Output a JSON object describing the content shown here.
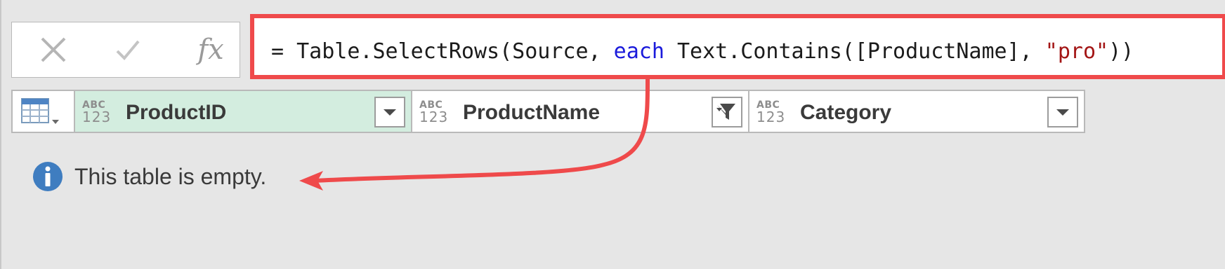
{
  "formula_bar": {
    "controls": [
      {
        "name": "cancel",
        "icon": "close-icon"
      },
      {
        "name": "commit",
        "icon": "checkmark-icon"
      },
      {
        "name": "insert-function",
        "label": "fx"
      }
    ],
    "formula": {
      "prefix": "= Table.SelectRows(Source, ",
      "keyword": "each",
      "middle": " Text.Contains([ProductName], ",
      "string": "\"pro\"",
      "suffix": "))"
    },
    "highlight_color": "#ef4a4b",
    "keyword_color": "#1a1adb",
    "string_color": "#a31515"
  },
  "table": {
    "select_icon": "table-icon",
    "columns": [
      {
        "name": "ProductID",
        "type_top": "ABC",
        "type_bottom": "123",
        "selected": true,
        "filter_icon": "dropdown-icon"
      },
      {
        "name": "ProductName",
        "type_top": "ABC",
        "type_bottom": "123",
        "selected": false,
        "filter_icon": "filter-icon"
      },
      {
        "name": "Category",
        "type_top": "ABC",
        "type_bottom": "123",
        "selected": false,
        "filter_icon": "dropdown-icon"
      }
    ],
    "selected_column_color": "#d3eddf"
  },
  "empty_message": {
    "icon": "info-icon",
    "text": "This table is empty."
  },
  "annotation": {
    "arrow_color": "#ef4a4b"
  }
}
